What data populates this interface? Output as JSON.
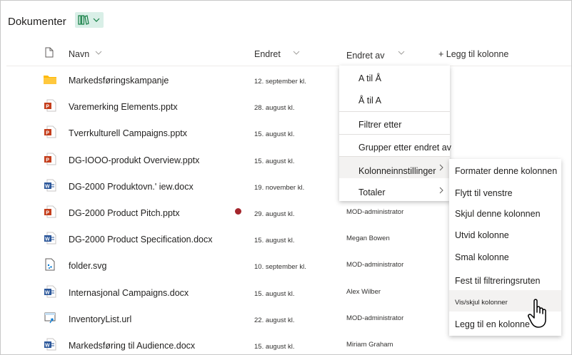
{
  "library": {
    "title": "Dokumenter"
  },
  "columns": {
    "name": "Navn",
    "modified": "Endret",
    "modified_by": "Endret av",
    "add_column": "+ Legg til kolonne"
  },
  "files": [
    {
      "name": "Markedsføringskampanje",
      "modified": "12. september kl.",
      "modified_by": "",
      "icon": "folder-icon"
    },
    {
      "name": "Varemerking Elements.pptx",
      "modified": "28. august kl.",
      "modified_by": "",
      "icon": "powerpoint-icon"
    },
    {
      "name": "Tverrkulturell Campaigns.pptx",
      "modified": "15. august kl.",
      "modified_by": "",
      "icon": "powerpoint-icon"
    },
    {
      "name": "DG-IOOO-produkt Overview.pptx",
      "modified": "15. august kl.",
      "modified_by": "",
      "icon": "powerpoint-icon"
    },
    {
      "name": "DG-2000 Produktovn.' iew.docx",
      "modified": "19. november kl.",
      "modified_by": "",
      "icon": "word-icon"
    },
    {
      "name": "DG-2000 Product Pitch.pptx",
      "modified": "29. august kl.",
      "modified_by": "MOD-administrator",
      "icon": "powerpoint-icon"
    },
    {
      "name": "DG-2000 Product Specification.docx",
      "modified": "15. august kl.",
      "modified_by": "Megan Bowen",
      "icon": "word-icon"
    },
    {
      "name": "folder.svg",
      "modified": "10. september kl.",
      "modified_by": "MOD-administrator",
      "icon": "image-file-icon"
    },
    {
      "name": "Internasjonal Campaigns.docx",
      "modified": "15. august kl.",
      "modified_by": "Alex Wilber",
      "icon": "word-icon"
    },
    {
      "name": "InventoryList.url",
      "modified": "22. august kl.",
      "modified_by": "MOD-administrator",
      "icon": "link-file-icon"
    },
    {
      "name": "Markedsføring til Audience.docx",
      "modified": "15. august kl.",
      "modified_by": "Miriam Graham",
      "icon": "word-icon"
    }
  ],
  "column_menu": {
    "sort_asc": "A til Å",
    "sort_desc": "Å til A",
    "filter_by": "Filtrer etter",
    "group_by": "Grupper etter endret av",
    "column_settings": "Kolonneinnstillinger",
    "totals": "Totaler"
  },
  "settings_submenu": {
    "format": "Formater denne kolonnen",
    "move_left": "Flytt til venstre",
    "hide": "Skjul denne kolonnen",
    "wide": "Utvid kolonne",
    "narrow": "Smal kolonne",
    "pin_filter": "Fest til filtreringsruten",
    "show_hide": "Vis/skjul kolonner",
    "add_column": "Legg til en kolonne"
  },
  "colors": {
    "accent": "#0078d4",
    "view_button_bg": "#d9efe7",
    "folder": "#ffb900",
    "powerpoint": "#c43e1c",
    "word": "#2b579a",
    "alert": "#a4262c"
  }
}
